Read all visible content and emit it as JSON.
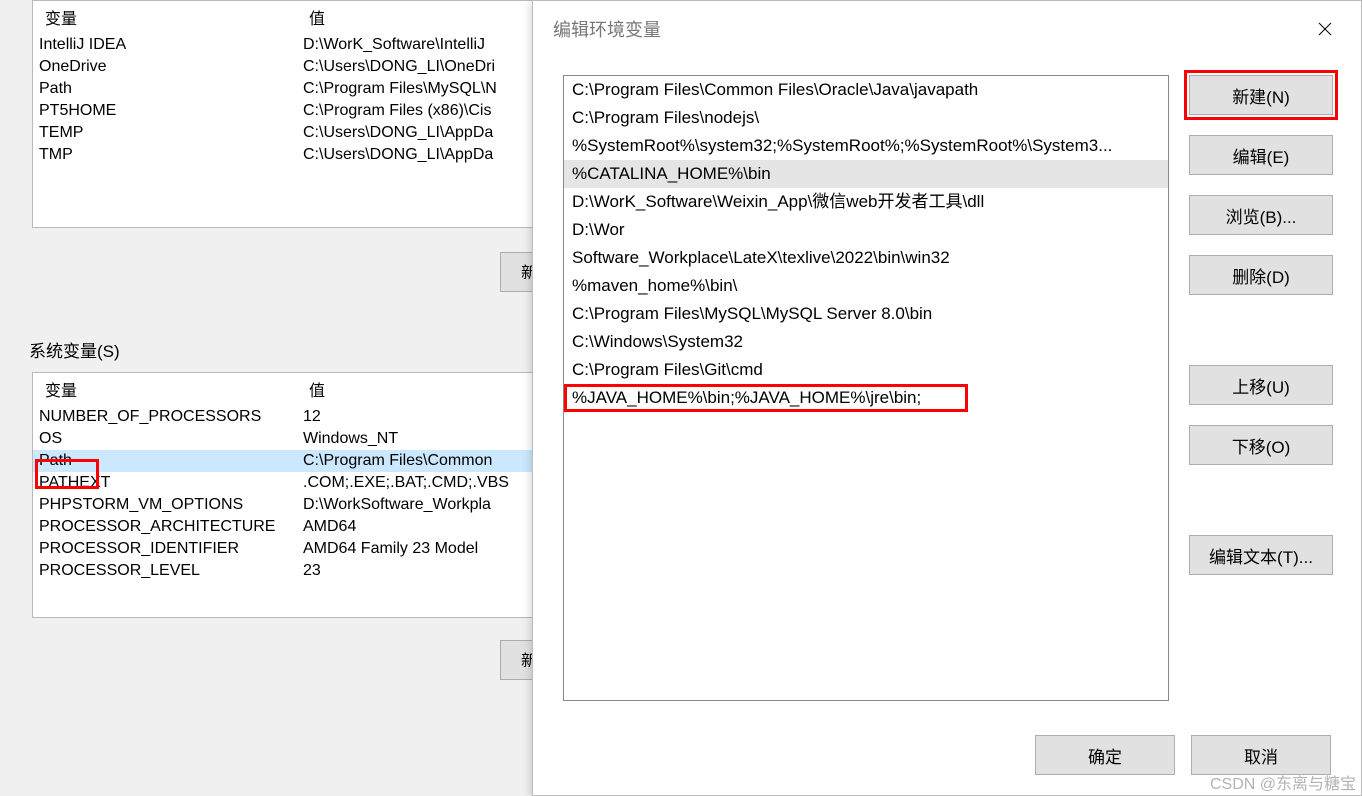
{
  "bg": {
    "header_var": "变量",
    "header_val": "值",
    "section_label": "系统变量(S)",
    "btn_new_trunc": "新",
    "user_vars": [
      {
        "name": "IntelliJ IDEA",
        "value": "D:\\WorK_Software\\IntelliJ"
      },
      {
        "name": "OneDrive",
        "value": "C:\\Users\\DONG_LI\\OneDri"
      },
      {
        "name": "Path",
        "value": "C:\\Program Files\\MySQL\\N"
      },
      {
        "name": "PT5HOME",
        "value": "C:\\Program Files (x86)\\Cis"
      },
      {
        "name": "TEMP",
        "value": "C:\\Users\\DONG_LI\\AppDa"
      },
      {
        "name": "TMP",
        "value": "C:\\Users\\DONG_LI\\AppDa"
      }
    ],
    "sys_vars": [
      {
        "name": "NUMBER_OF_PROCESSORS",
        "value": "12"
      },
      {
        "name": "OS",
        "value": "Windows_NT"
      },
      {
        "name": "Path",
        "value": "C:\\Program Files\\Common",
        "selected": true
      },
      {
        "name": "PATHEXT",
        "value": ".COM;.EXE;.BAT;.CMD;.VBS"
      },
      {
        "name": "PHPSTORM_VM_OPTIONS",
        "value": "D:\\WorkSoftware_Workpla"
      },
      {
        "name": "PROCESSOR_ARCHITECTURE",
        "value": "AMD64"
      },
      {
        "name": "PROCESSOR_IDENTIFIER",
        "value": "AMD64 Family 23 Model"
      },
      {
        "name": "PROCESSOR_LEVEL",
        "value": "23"
      }
    ]
  },
  "dialog": {
    "title": "编辑环境变量",
    "items": [
      {
        "text": "C:\\Program Files\\Common Files\\Oracle\\Java\\javapath"
      },
      {
        "text": "C:\\Program Files\\nodejs\\"
      },
      {
        "text": "%SystemRoot%\\system32;%SystemRoot%;%SystemRoot%\\System3..."
      },
      {
        "text": "%CATALINA_HOME%\\bin",
        "selected": true
      },
      {
        "text": "D:\\WorK_Software\\Weixin_App\\微信web开发者工具\\dll"
      },
      {
        "text": "D:\\Wor"
      },
      {
        "text": "Software_Workplace\\LateX\\texlive\\2022\\bin\\win32"
      },
      {
        "text": "%maven_home%\\bin\\"
      },
      {
        "text": "C:\\Program Files\\MySQL\\MySQL Server 8.0\\bin"
      },
      {
        "text": "C:\\Windows\\System32"
      },
      {
        "text": "C:\\Program Files\\Git\\cmd"
      },
      {
        "text": "%JAVA_HOME%\\bin;%JAVA_HOME%\\jre\\bin;"
      }
    ],
    "buttons": {
      "new": "新建(N)",
      "edit": "编辑(E)",
      "browse": "浏览(B)...",
      "delete": "删除(D)",
      "moveup": "上移(U)",
      "movedown": "下移(O)",
      "edittext": "编辑文本(T)...",
      "ok": "确定",
      "cancel": "取消"
    }
  },
  "watermark": "CSDN @东离与糖宝"
}
